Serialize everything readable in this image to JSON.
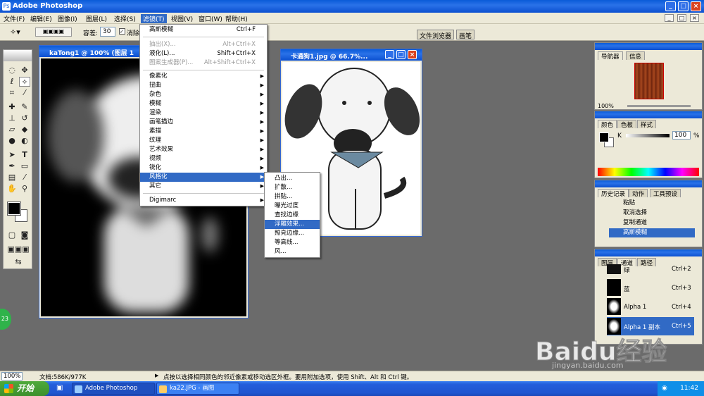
{
  "app": {
    "title": "Adobe Photoshop"
  },
  "menubar": {
    "items": [
      "文件(F)",
      "编辑(E)",
      "图像(I)",
      "图层(L)",
      "选择(S)",
      "滤镜(T)",
      "视图(V)",
      "窗口(W)",
      "帮助(H)"
    ]
  },
  "options": {
    "tolerance_label": "容差:",
    "tolerance_value": "30",
    "antialias_label": "消除"
  },
  "palette_well": {
    "tabs": [
      "文件浏览器",
      "画笔"
    ]
  },
  "filter_menu": {
    "top": [
      {
        "label": "高斯模糊",
        "shortcut": "Ctrl+F"
      }
    ],
    "group2": [
      {
        "label": "抽出(X)...",
        "shortcut": "Alt+Ctrl+X"
      },
      {
        "label": "液化(L)...",
        "shortcut": "Shift+Ctrl+X"
      },
      {
        "label": "图案生成器(P)...",
        "shortcut": "Alt+Shift+Ctrl+X"
      }
    ],
    "group3": [
      "像素化",
      "扭曲",
      "杂色",
      "模糊",
      "渲染",
      "画笔描边",
      "素描",
      "纹理",
      "艺术效果",
      "视频",
      "锐化",
      "风格化",
      "其它"
    ],
    "group4": [
      "Digimarc"
    ]
  },
  "stylize_submenu": [
    "凸出...",
    "扩散...",
    "拼贴...",
    "曝光过度",
    "查找边缘",
    "浮雕效果...",
    "照亮边缘...",
    "等高线...",
    "风..."
  ],
  "doc1": {
    "title": "kaTong1 @ 100% (图层 1"
  },
  "doc2": {
    "title": "卡通狗1.jpg @ 66.7%..."
  },
  "navigator": {
    "tabs": [
      "导航器",
      "信息"
    ],
    "zoom": "100%"
  },
  "color": {
    "tabs": [
      "颜色",
      "色板",
      "样式"
    ],
    "channel": "K",
    "value": "100",
    "unit": "%"
  },
  "history": {
    "tabs": [
      "历史记录",
      "动作",
      "工具预设"
    ],
    "items": [
      "粘贴",
      "取消选择",
      "复制通道",
      "高斯模糊"
    ]
  },
  "channels": {
    "tabs": [
      "图层",
      "通道",
      "路径"
    ],
    "rows": [
      {
        "name": "绿",
        "shortcut": "Ctrl+2"
      },
      {
        "name": "蓝",
        "shortcut": "Ctrl+3"
      },
      {
        "name": "Alpha 1",
        "shortcut": "Ctrl+4"
      },
      {
        "name": "Alpha 1 副本",
        "shortcut": "Ctrl+5"
      }
    ]
  },
  "status": {
    "zoom": "100%",
    "doc": "文档:586K/977K",
    "hint": "点按以选择相同颜色的邻近像素或移动选区外框。要用附加选项，使用 Shift、Alt 和 Ctrl 键。"
  },
  "taskbar": {
    "start": "开始",
    "tasks": [
      "Adobe Photoshop",
      "ka22.JPG - 画图"
    ],
    "clock": "11:42"
  },
  "watermark": {
    "brand": "Baidu经验",
    "url": "jingyan.baidu.com"
  },
  "badge": "23",
  "colors": {
    "xp_blue": "#0a5bd8",
    "highlight": "#316ac5",
    "menu_bg": "#ece9d8"
  }
}
